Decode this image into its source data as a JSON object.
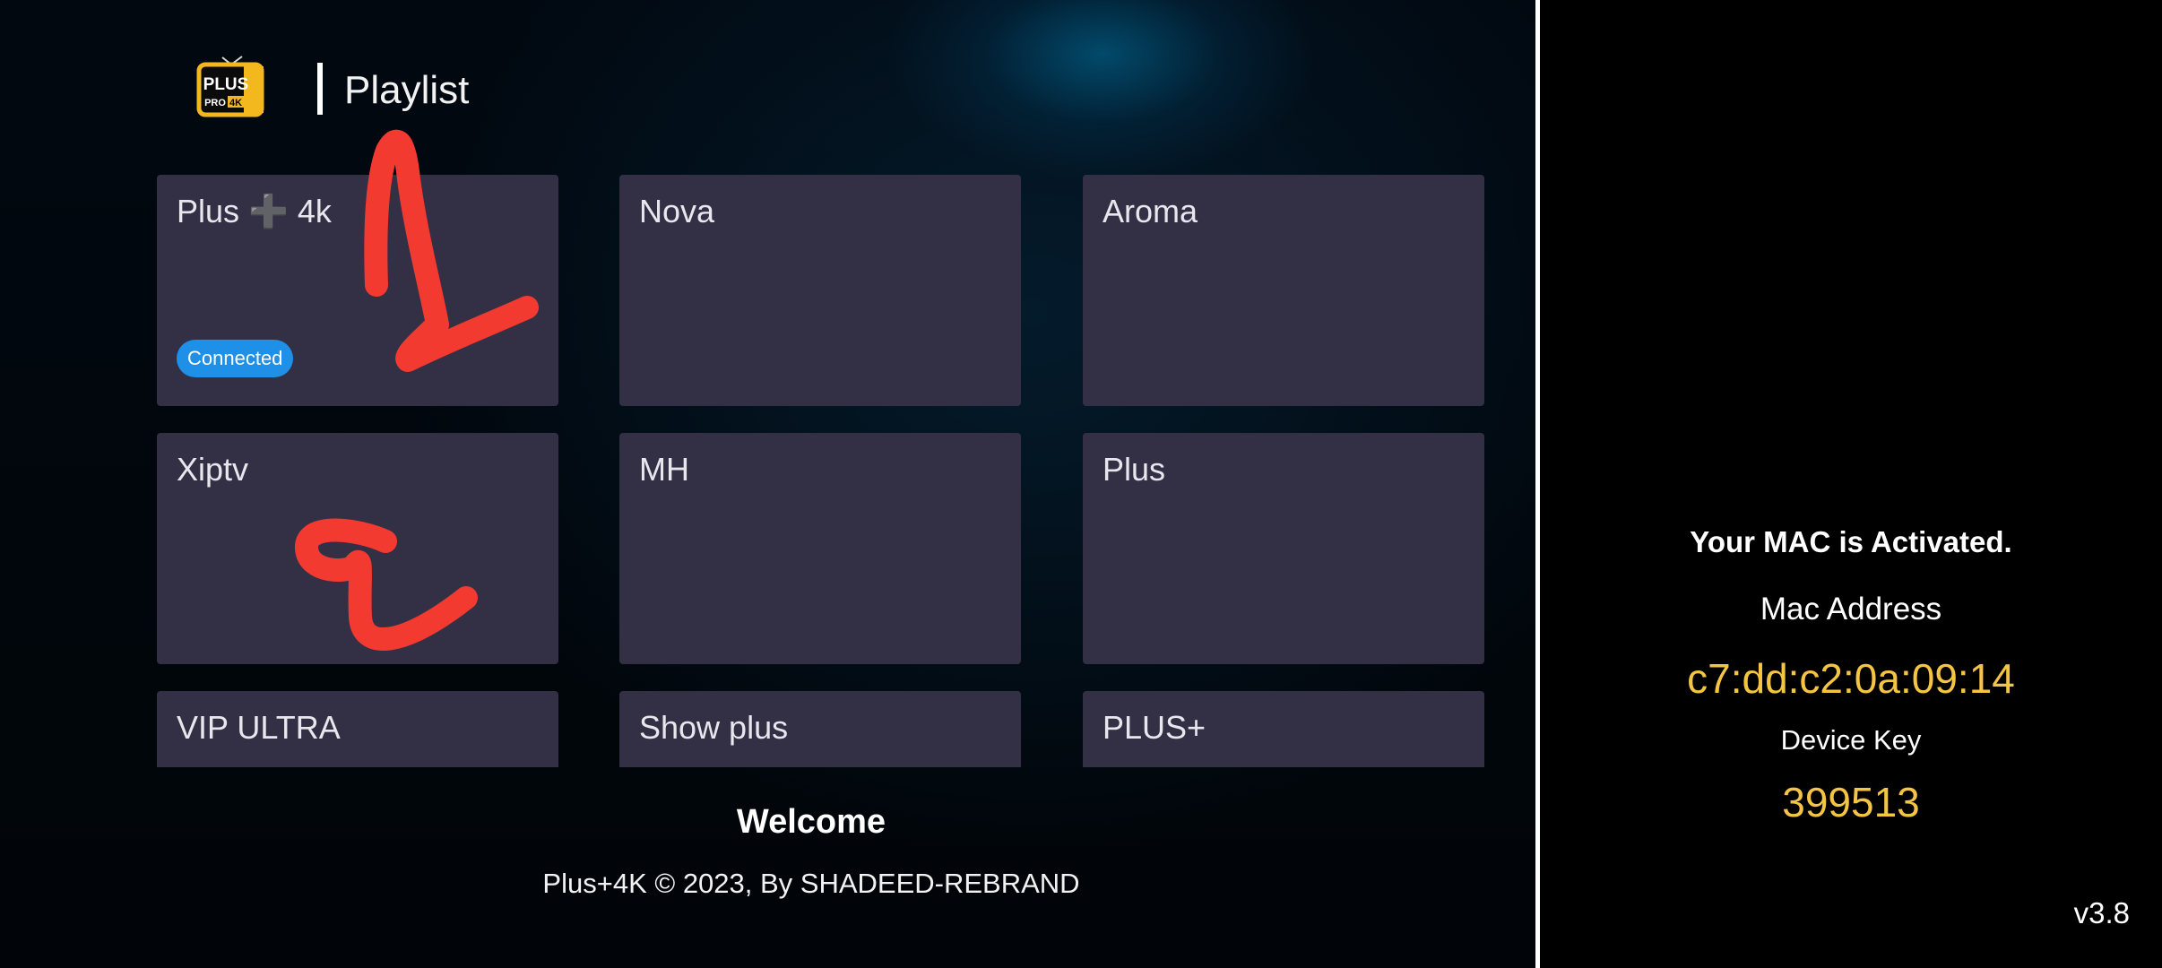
{
  "header": {
    "logo_text_top": "PLUS",
    "logo_text_pro": "PRO",
    "logo_text_4k": "4K",
    "title": "Playlist"
  },
  "playlists": [
    {
      "label": "Plus ➕ 4k",
      "badge": "Connected"
    },
    {
      "label": "Nova"
    },
    {
      "label": "Aroma"
    },
    {
      "label": "Xiptv"
    },
    {
      "label": "MH"
    },
    {
      "label": "Plus"
    },
    {
      "label": "VIP ULTRA"
    },
    {
      "label": "Show plus"
    },
    {
      "label": "PLUS+"
    }
  ],
  "footer": {
    "welcome": "Welcome",
    "copyright": "Plus+4K © 2023, By SHADEED-REBRAND"
  },
  "device": {
    "status": "Your MAC is Activated.",
    "mac_label": "Mac Address",
    "mac_value": "c7:dd:c2:0a:09:14",
    "key_label": "Device Key",
    "key_value": "399513",
    "version": "v3.8"
  },
  "colors": {
    "card_bg": "#333045",
    "badge_bg": "#1e90e8",
    "accent_yellow": "#f4c542",
    "annotation_red": "#f23a30"
  }
}
